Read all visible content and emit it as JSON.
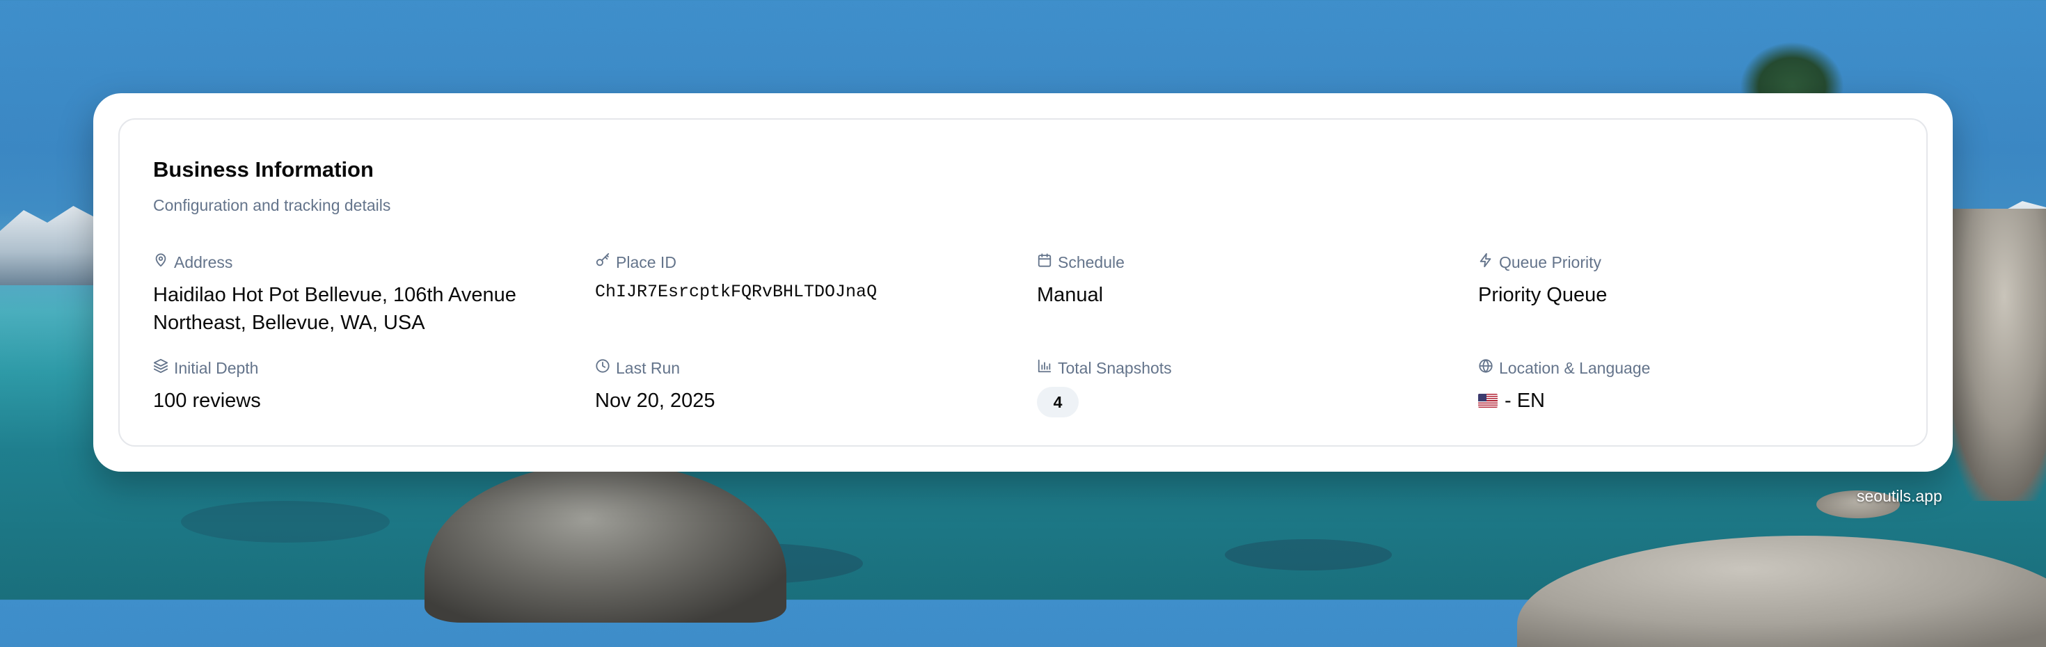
{
  "card": {
    "title": "Business Information",
    "subtitle": "Configuration and tracking details"
  },
  "fields": {
    "address": {
      "label": "Address",
      "value": "Haidilao Hot Pot Bellevue, 106th Avenue Northeast, Bellevue, WA, USA",
      "icon": "map-pin-icon"
    },
    "place_id": {
      "label": "Place ID",
      "value": "ChIJR7EsrcptkFQRvBHLTDOJnaQ",
      "icon": "key-icon"
    },
    "schedule": {
      "label": "Schedule",
      "value": "Manual",
      "icon": "calendar-icon"
    },
    "queue_priority": {
      "label": "Queue Priority",
      "value": "Priority Queue",
      "icon": "lightning-icon"
    },
    "initial_depth": {
      "label": "Initial Depth",
      "value": "100 reviews",
      "icon": "layers-icon"
    },
    "last_run": {
      "label": "Last Run",
      "value": "Nov 20, 2025",
      "icon": "clock-icon"
    },
    "total_snapshots": {
      "label": "Total Snapshots",
      "value": "4",
      "icon": "bar-chart-icon"
    },
    "location_language": {
      "label": "Location & Language",
      "value": "- EN",
      "flag": "us-flag-icon",
      "icon": "globe-icon"
    }
  },
  "watermark": "seoutils.app",
  "colors": {
    "label": "#64748b",
    "text": "#0a0a0a",
    "badge_bg": "#eef2f6",
    "card_border": "#e5e7eb"
  }
}
